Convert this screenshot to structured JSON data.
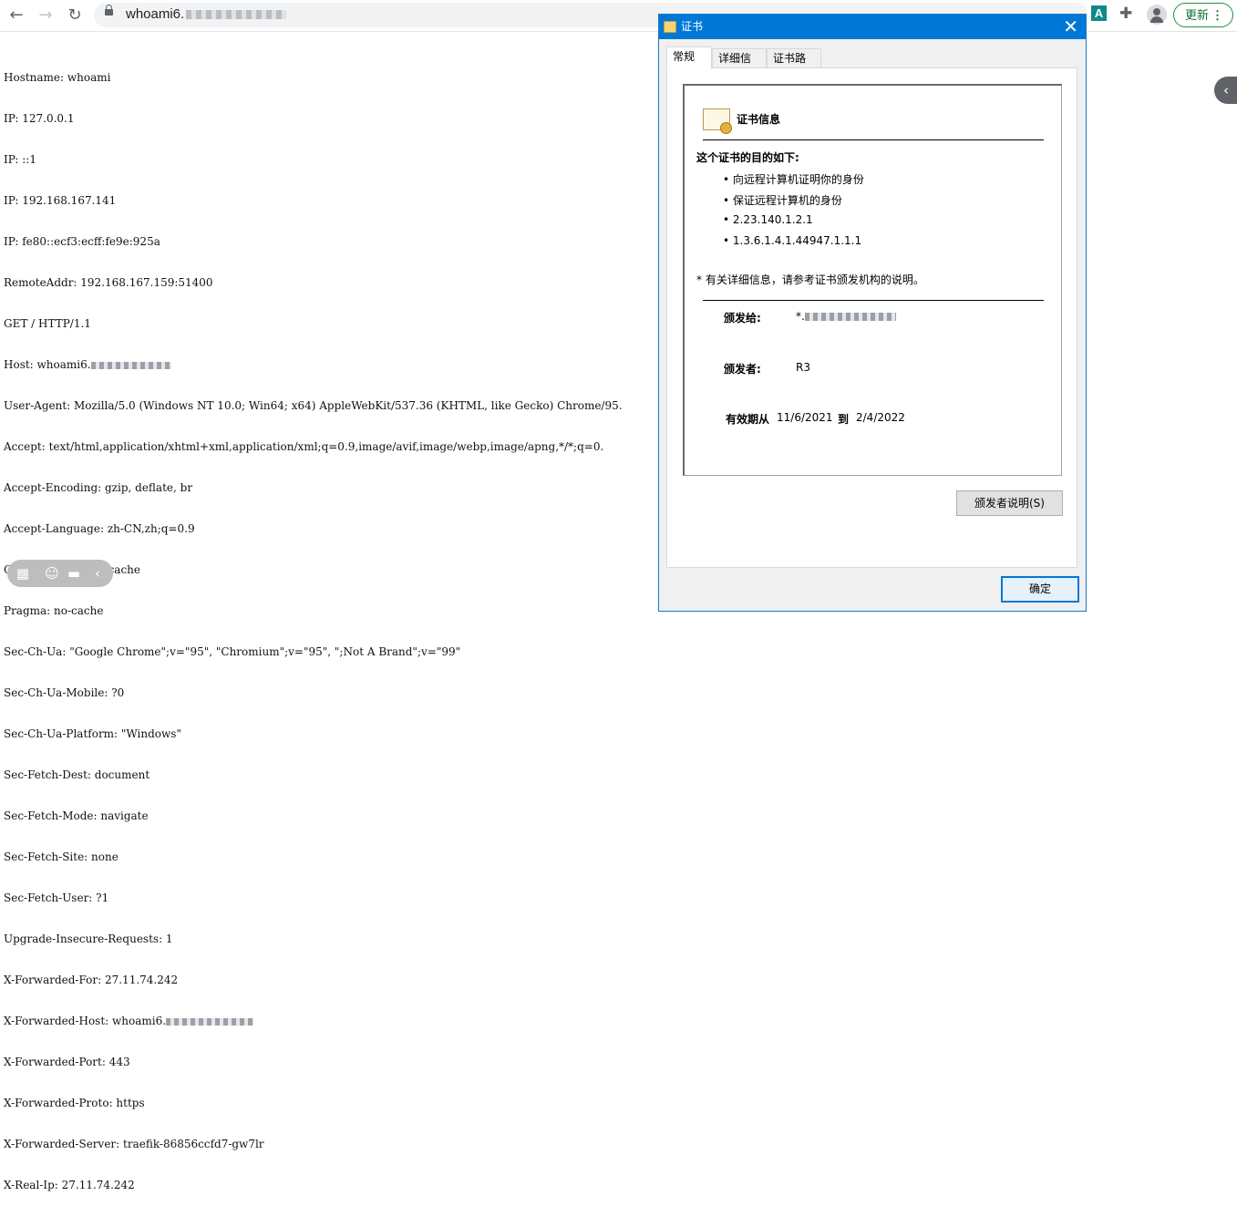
{
  "browser": {
    "url_visible": "whoami6.",
    "update_label": "更新",
    "more_glyph": "⋮",
    "extension_a": "A"
  },
  "request_lines": [
    "Hostname: whoami",
    "IP: 127.0.0.1",
    "IP: ::1",
    "IP: 192.168.167.141",
    "IP: fe80::ecf3:ecff:fe9e:925a",
    "RemoteAddr: 192.168.167.159:51400",
    "GET / HTTP/1.1",
    "Host: whoami6.",
    "User-Agent: Mozilla/5.0 (Windows NT 10.0; Win64; x64) AppleWebKit/537.36 (KHTML, like Gecko) Chrome/95.",
    "Accept: text/html,application/xhtml+xml,application/xml;q=0.9,image/avif,image/webp,image/apng,*/*;q=0.",
    "Accept-Encoding: gzip, deflate, br",
    "Accept-Language: zh-CN,zh;q=0.9",
    "Cache-Control: no-cache",
    "Pragma: no-cache",
    "Sec-Ch-Ua: \"Google Chrome\";v=\"95\", \"Chromium\";v=\"95\", \";Not A Brand\";v=\"99\"",
    "Sec-Ch-Ua-Mobile: ?0",
    "Sec-Ch-Ua-Platform: \"Windows\"",
    "Sec-Fetch-Dest: document",
    "Sec-Fetch-Mode: navigate",
    "Sec-Fetch-Site: none",
    "Sec-Fetch-User: ?1",
    "Upgrade-Insecure-Requests: 1",
    "X-Forwarded-For: 27.11.74.242",
    "X-Forwarded-Host: whoami6.",
    "X-Forwarded-Port: 443",
    "X-Forwarded-Proto: https",
    "X-Forwarded-Server: traefik-86856ccfd7-gw7lr",
    "X-Real-Ip: 27.11.74.242"
  ],
  "dialog": {
    "title": "证书",
    "close": "✕",
    "tabs": [
      "常规",
      "详细信息",
      "证书路径"
    ],
    "cert_info_heading": "证书信息",
    "purpose_title": "这个证书的目的如下:",
    "purposes": [
      "向远程计算机证明你的身份",
      "保证远程计算机的身份",
      "2.23.140.1.2.1",
      "1.3.6.1.4.1.44947.1.1.1"
    ],
    "note": "* 有关详细信息，请参考证书颁发机构的说明。",
    "issued_to_label": "颁发给:",
    "issued_to_value": "*.",
    "issued_by_label": "颁发者:",
    "issued_by_value": "R3",
    "validity_label": "有效期从",
    "valid_from": "11/6/2021",
    "to_label": "到",
    "valid_to": "2/4/2022",
    "issuer_statement_button": "颁发者说明(S)",
    "ok_button": "确定"
  }
}
